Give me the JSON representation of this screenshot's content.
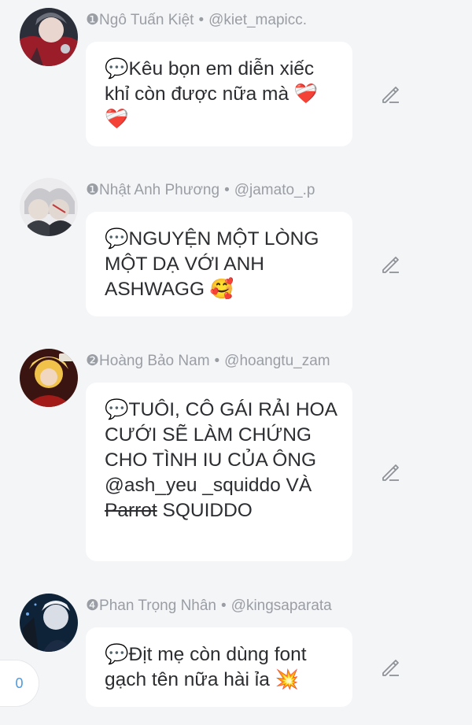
{
  "comments": [
    {
      "rank": "❶",
      "name": "Ngô Tuấn Kiệt",
      "separator": "•",
      "handle": "@kiet_mapicc.",
      "icon": "speech-balloon-icon",
      "text": "Kêu bọn em diễn xiếc khỉ còn được nữa mà ❤️‍🩹❤️‍🩹"
    },
    {
      "rank": "❶",
      "name": "Nhật Anh Phương",
      "separator": "•",
      "handle": "@jamato_.p",
      "icon": "speech-balloon-icon",
      "text": "NGUYỆN MỘT LÒNG MỘT DẠ VỚI ANH ASHWAGG 🥰"
    },
    {
      "rank": "❷",
      "name": "Hoàng Bảo Nam",
      "separator": "•",
      "handle": "@hoangtu_zam",
      "icon": "speech-balloon-icon",
      "text_before": "TUÔI, CÔ GÁI RẢI HOA CƯỚI SẼ LÀM CHỨNG CHO TÌNH IU CỦA ÔNG @ash_yeu _squiddo VÀ ",
      "text_struck": "Parrot",
      "text_after": " SQUIDDO"
    },
    {
      "rank": "❹",
      "name": "Phan Trọng Nhân",
      "separator": "•",
      "handle": "@kingsaparata",
      "icon": "speech-balloon-icon",
      "text": "Địt mẹ còn dùng font gạch tên nữa hài ỉa 💥"
    }
  ],
  "counter": {
    "value": "0"
  },
  "colors": {
    "background": "#f4f5f7",
    "bubble": "#ffffff",
    "meta_text": "#9a9ea4",
    "body_text": "#2b2d30",
    "counter_text": "#4a9be3",
    "edit_icon": "#8e9297"
  }
}
